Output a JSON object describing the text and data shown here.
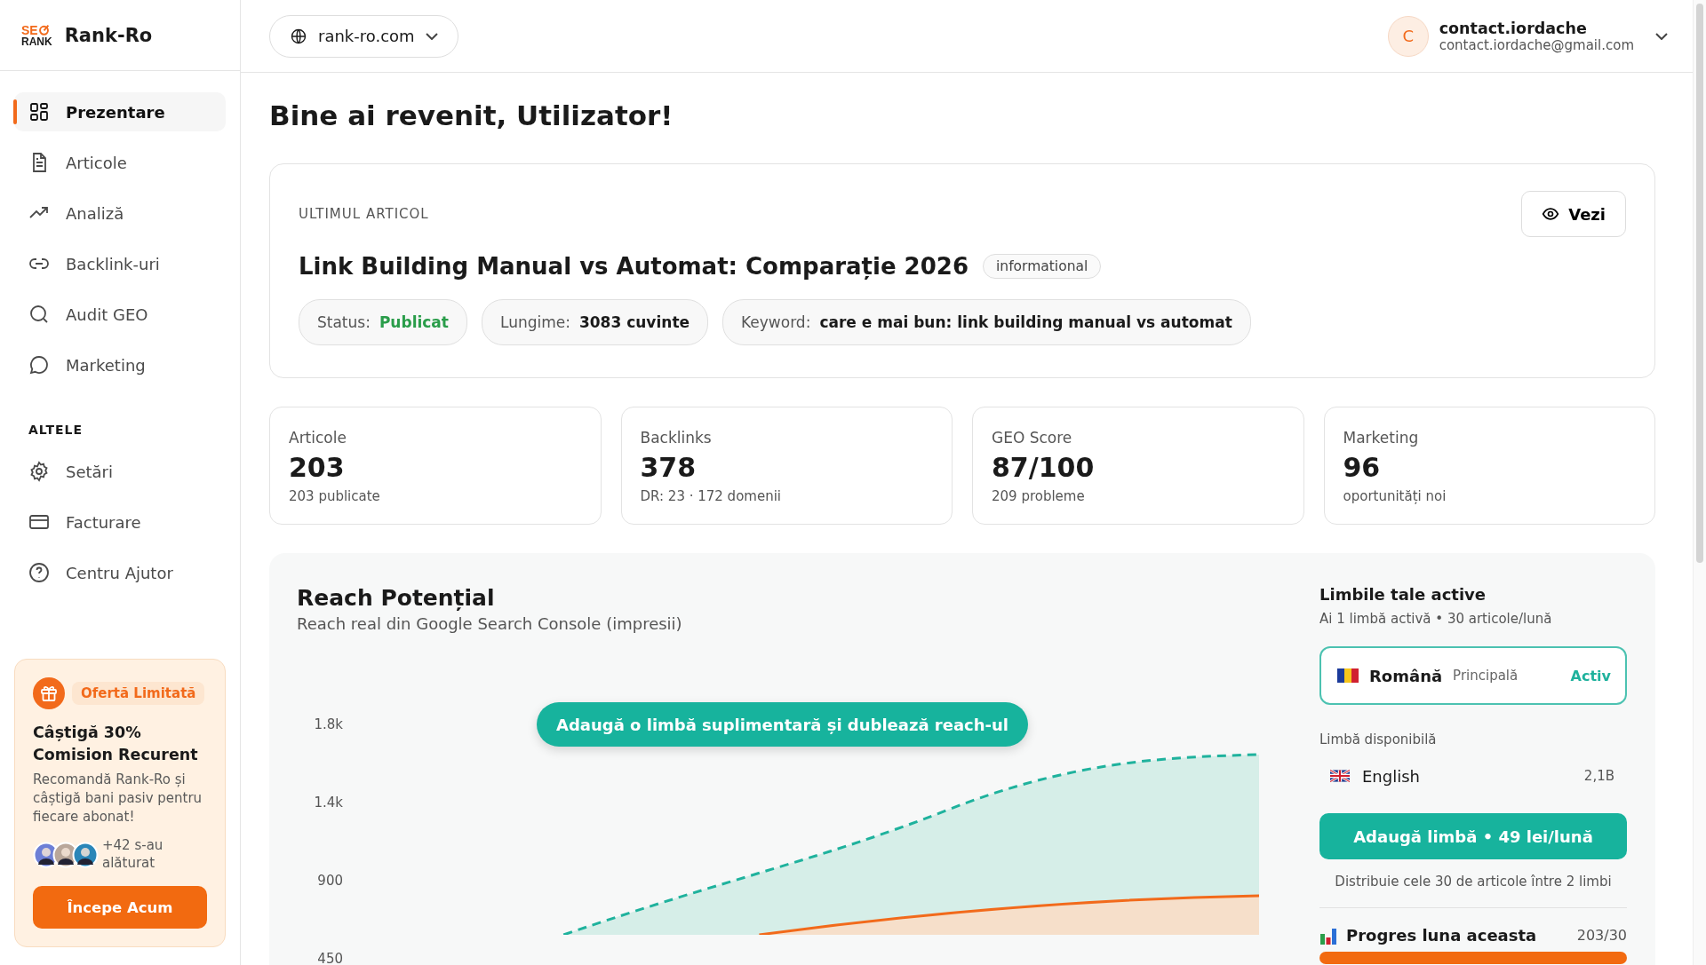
{
  "brand": {
    "logo_top": "SE",
    "logo_bottom": "RANK",
    "name": "Rank-Ro"
  },
  "sidebar": {
    "items": [
      {
        "label": "Prezentare",
        "selected": true
      },
      {
        "label": "Articole",
        "selected": false
      },
      {
        "label": "Analiză",
        "selected": false
      },
      {
        "label": "Backlink-uri",
        "selected": false
      },
      {
        "label": "Audit GEO",
        "selected": false
      },
      {
        "label": "Marketing",
        "selected": false
      }
    ],
    "section_title": "ALTELE",
    "other_items": [
      {
        "label": "Setări",
        "selected": false
      },
      {
        "label": "Facturare",
        "selected": false
      },
      {
        "label": "Centru Ajutor",
        "selected": false
      }
    ]
  },
  "promo": {
    "badge": "Ofertă Limitată",
    "title": "Câștigă 30% Comision Recurent",
    "text": "Recomandă Rank-Ro și câștigă bani pasiv pentru fiecare abonat!",
    "joined": "+42 s-au alăturat",
    "button": "Începe Acum"
  },
  "header": {
    "site": "rank-ro.com",
    "user": {
      "initial": "C",
      "name": "contact.iordache",
      "email": "contact.iordache@gmail.com"
    }
  },
  "greeting": "Bine ai revenit, Utilizator!",
  "latest_article": {
    "label": "ULTIMUL ARTICOL",
    "view_button": "Vezi",
    "title": "Link Building Manual vs Automat: Comparație 2026",
    "tag": "informational",
    "meta": [
      {
        "label": "Status:",
        "value": "Publicat",
        "kind": "status"
      },
      {
        "label": "Lungime:",
        "value": "3083 cuvinte",
        "kind": "plain"
      },
      {
        "label": "Keyword:",
        "value": "care e mai bun: link building manual vs automat",
        "kind": "plain"
      }
    ]
  },
  "stats": [
    {
      "label": "Articole",
      "value": "203",
      "detail": "203 publicate"
    },
    {
      "label": "Backlinks",
      "value": "378",
      "detail": "DR: 23 · 172 domenii"
    },
    {
      "label": "GEO Score",
      "value": "87/100",
      "detail": "209 probleme"
    },
    {
      "label": "Marketing",
      "value": "96",
      "detail": "oportunități noi"
    }
  ],
  "reach": {
    "title": "Reach Potențial",
    "subtitle": "Reach real din Google Search Console (impresii)",
    "cta": "Adaugă o limbă suplimentară și dublează reach-ul",
    "y_labels": [
      "1.8k",
      "1.4k",
      "900",
      "450"
    ]
  },
  "languages": {
    "title": "Limbile tale active",
    "subtitle": "Ai 1 limbă activă • 30 articole/lună",
    "active": {
      "name": "Română",
      "role": "Principală",
      "status": "Activ"
    },
    "available_label": "Limbă disponibilă",
    "available": {
      "name": "English",
      "reach": "2,1B"
    },
    "add_button": "Adaugă limbă • 49 lei/lună",
    "note": "Distribuie cele 30 de articole între 2 limbi",
    "progress": {
      "label": "Progres luna aceasta",
      "count": "203/30",
      "level": 1
    }
  }
}
